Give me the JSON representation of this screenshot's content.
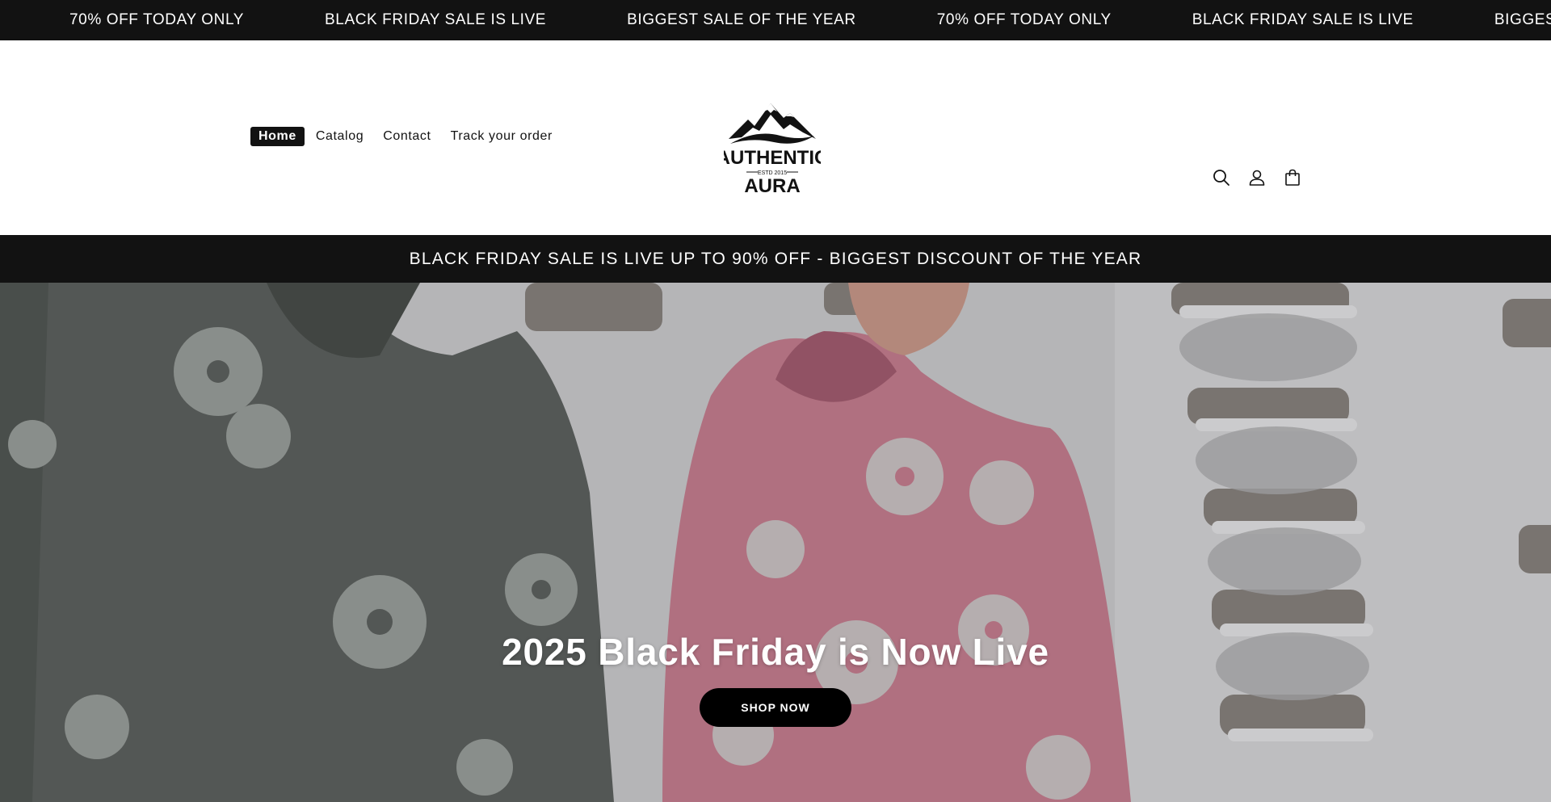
{
  "marquee": {
    "items": [
      "70% OFF TODAY ONLY",
      "BLACK FRIDAY SALE IS LIVE",
      "BIGGEST SALE OF THE YEAR",
      "70% OFF TODAY ONLY",
      "BLACK FRIDAY SALE IS LIVE",
      "BIGGEST SALE OF THE YEAR"
    ]
  },
  "nav": {
    "items": [
      {
        "label": "Home",
        "active": true
      },
      {
        "label": "Catalog",
        "active": false
      },
      {
        "label": "Contact",
        "active": false
      },
      {
        "label": "Track your order",
        "active": false
      }
    ]
  },
  "logo": {
    "line1": "AUTHENTIC",
    "line2": "ESTD 2015",
    "line3": "AURA"
  },
  "header_icons": [
    "search-icon",
    "account-icon",
    "cart-icon"
  ],
  "announcement": {
    "text": "BLACK FRIDAY SALE IS LIVE UP TO 90% OFF - BIGGEST DISCOUNT OF THE YEAR"
  },
  "hero": {
    "title": "2025 Black Friday is Now Live",
    "cta_label": "SHOP NOW"
  },
  "colors": {
    "dark": "#121212",
    "white": "#ffffff",
    "hero_grey_hoodie": "#5d625e",
    "hero_pink_hoodie": "#c77e8f",
    "hero_wall": "#d3d3d5"
  }
}
